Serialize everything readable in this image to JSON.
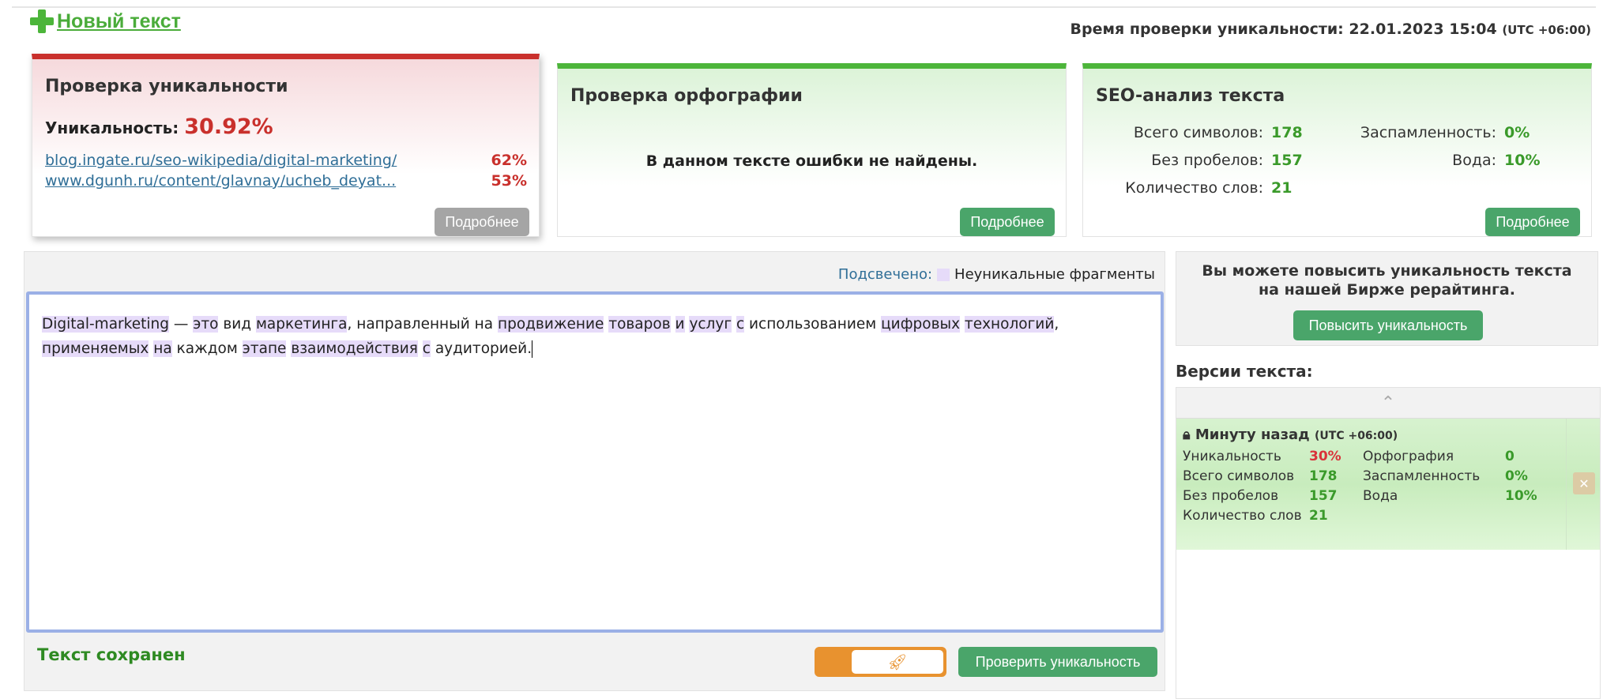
{
  "header": {
    "new_text": "Новый текст",
    "time_label": "Время проверки уникальности:",
    "time_value": "22.01.2023 15:04",
    "tz": "(UTC +06:00)"
  },
  "uniqueness": {
    "title": "Проверка уникальности",
    "label": "Уникальность:",
    "value": "30.92%",
    "sources": [
      {
        "url": "blog.ingate.ru/seo-wikipedia/digital-marketing/",
        "pct": "62%"
      },
      {
        "url": "www.dgunh.ru/content/glavnay/ucheb_deyat...",
        "pct": "53%"
      }
    ],
    "more": "Подробнее"
  },
  "spelling": {
    "title": "Проверка орфографии",
    "message": "В данном тексте ошибки не найдены.",
    "more": "Подробнее"
  },
  "seo": {
    "title": "SEO-анализ текста",
    "total_label": "Всего символов:",
    "total": "178",
    "nospace_label": "Без пробелов:",
    "nospace": "157",
    "words_label": "Количество слов:",
    "words": "21",
    "spam_label": "Заспамленность:",
    "spam": "0%",
    "water_label": "Вода:",
    "water": "10%",
    "more": "Подробнее"
  },
  "editor": {
    "legend_label": "Подсвечено:",
    "legend_text": "Неуникальные фрагменты",
    "segments": [
      [
        "Digital-marketing",
        1
      ],
      [
        " — ",
        0
      ],
      [
        "это",
        1
      ],
      [
        " вид ",
        0
      ],
      [
        "маркетинга",
        1
      ],
      [
        ", направленный на ",
        0
      ],
      [
        "продвижение",
        1
      ],
      [
        " ",
        0
      ],
      [
        "товаров",
        1
      ],
      [
        " ",
        0
      ],
      [
        "и",
        1
      ],
      [
        " ",
        0
      ],
      [
        "услуг",
        1
      ],
      [
        " ",
        0
      ],
      [
        "с",
        1
      ],
      [
        " использованием ",
        0
      ],
      [
        "цифровых",
        1
      ],
      [
        " ",
        0
      ],
      [
        "технологий",
        1
      ],
      [
        ", ",
        0
      ],
      [
        "применяемых",
        1
      ],
      [
        " ",
        0
      ],
      [
        "на",
        1
      ],
      [
        " каждом ",
        0
      ],
      [
        "этапе",
        1
      ],
      [
        " ",
        0
      ],
      [
        "взаимодействия",
        1
      ],
      [
        " ",
        0
      ],
      [
        "с",
        1
      ],
      [
        " аудиторией.",
        0
      ]
    ],
    "status": "Текст сохранен",
    "check_button": "Проверить уникальность",
    "highlight_color": "#e6dbf9"
  },
  "promo": {
    "text": "Вы можете повысить уникальность текста на нашей Бирже рерайтинга.",
    "button": "Повысить уникальность"
  },
  "versions": {
    "title": "Версии текста:",
    "items": [
      {
        "time": "Минуту назад",
        "tz": "(UTC +06:00)",
        "uniq_label": "Уникальность",
        "uniq": "30%",
        "spell_label": "Орфография",
        "spell": "0",
        "total_label": "Всего символов",
        "total": "178",
        "spam_label": "Заспамленность",
        "spam": "0%",
        "nospace_label": "Без пробелов",
        "nospace": "157",
        "water_label": "Вода",
        "water": "10%",
        "words_label": "Количество слов",
        "words": "21"
      }
    ]
  }
}
